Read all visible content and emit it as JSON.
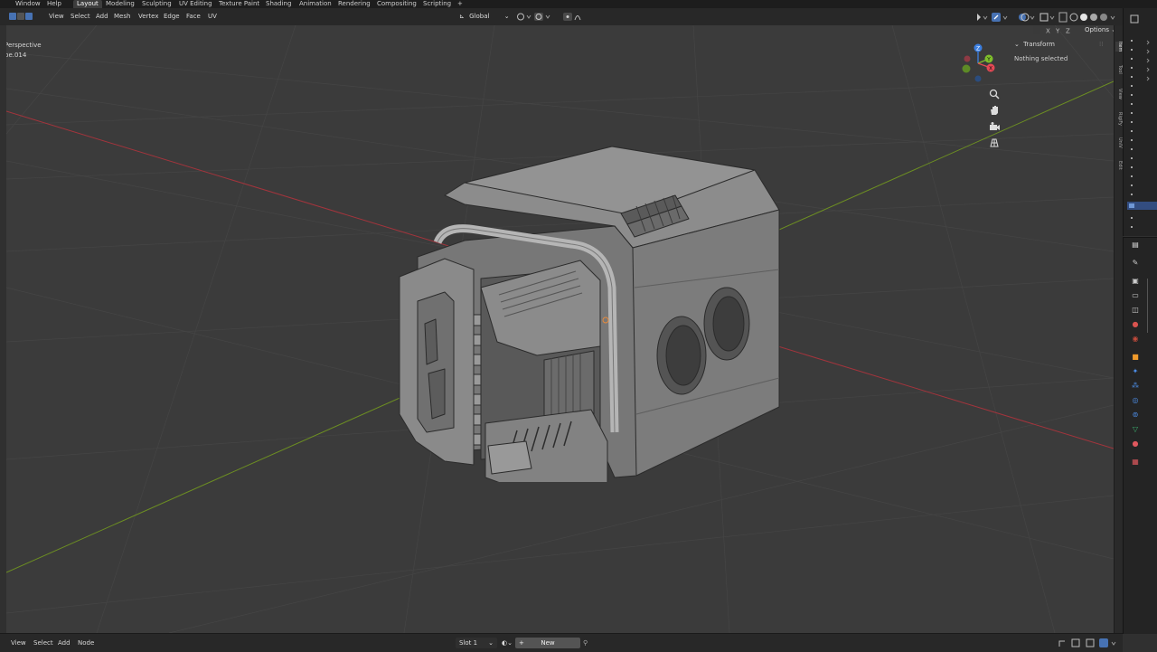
{
  "top_menu": {
    "window": "Window",
    "help": "Help",
    "workspaces": [
      {
        "label": "Layout",
        "active": true
      },
      {
        "label": "Modeling",
        "active": false
      },
      {
        "label": "Sculpting",
        "active": false
      },
      {
        "label": "UV Editing",
        "active": false
      },
      {
        "label": "Texture Paint",
        "active": false
      },
      {
        "label": "Shading",
        "active": false
      },
      {
        "label": "Animation",
        "active": false
      },
      {
        "label": "Rendering",
        "active": false
      },
      {
        "label": "Compositing",
        "active": false
      },
      {
        "label": "Scripting",
        "active": false
      }
    ],
    "add_workspace": "+"
  },
  "viewport_header": {
    "menus": [
      "View",
      "Select",
      "Add",
      "Mesh",
      "Vertex",
      "Edge",
      "Face",
      "UV"
    ],
    "transform_orientation": "Global",
    "options": "Options",
    "axes": [
      "X",
      "Y",
      "Z"
    ]
  },
  "viewport": {
    "view_name": "Perspective",
    "object_name": "be.014",
    "gizmo_axes": [
      "Z",
      "Y",
      "X"
    ],
    "nav_icons": [
      "zoom-icon",
      "hand-pan-icon",
      "camera-icon",
      "grid-ortho-icon"
    ]
  },
  "n_panel": {
    "section_title": "Transform",
    "status": "Nothing selected"
  },
  "sidebar_tabs": [
    "Item",
    "Tool",
    "View",
    "RigiFy",
    "UniV",
    "Edit"
  ],
  "bottom_bar": {
    "menus": [
      "View",
      "Select",
      "Add",
      "Node"
    ],
    "slot": "Slot 1",
    "new_button": "New"
  },
  "colors": {
    "accent": "#4772b3",
    "axis_x": "#a3343c",
    "axis_y": "#6d8f22",
    "gizmo_x": "#e54955",
    "gizmo_y": "#7fbf2b",
    "gizmo_z": "#3c7fe0"
  }
}
